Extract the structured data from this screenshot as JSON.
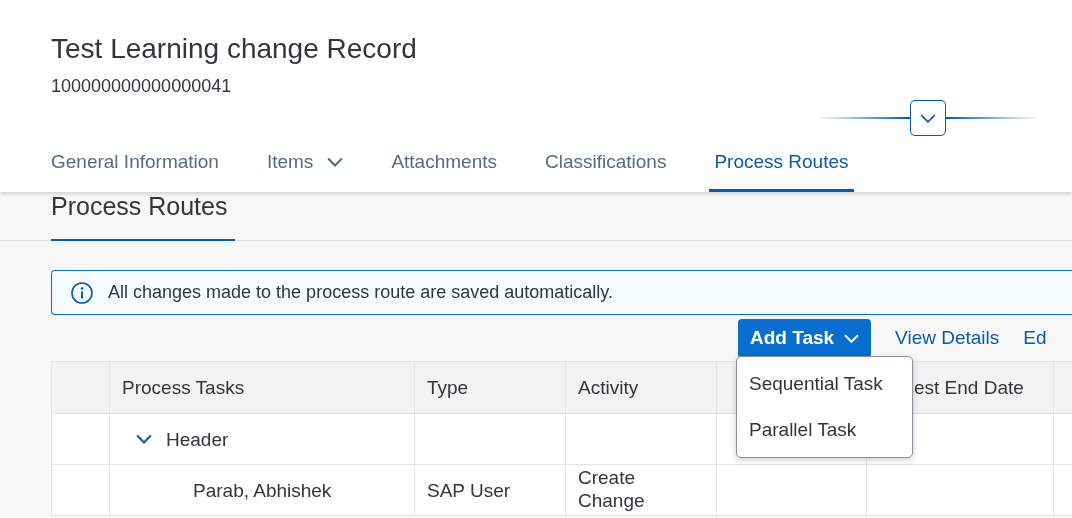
{
  "object_header": {
    "title": "Test Learning change Record",
    "number": "100000000000000041",
    "header_collapsed": false
  },
  "tabs": [
    {
      "label": "General Information",
      "selected": false,
      "has_menu": false
    },
    {
      "label": "Items",
      "selected": false,
      "has_menu": true
    },
    {
      "label": "Attachments",
      "selected": false,
      "has_menu": false
    },
    {
      "label": "Classifications",
      "selected": false,
      "has_menu": false
    },
    {
      "label": "Process Routes",
      "selected": true,
      "has_menu": false
    }
  ],
  "section": {
    "title": "Process Routes"
  },
  "info_strip": {
    "text": "All changes made to the process route are saved automatically."
  },
  "toolbar": {
    "add_button": "Add Task",
    "links": [
      "View Details",
      "Ed"
    ]
  },
  "add_menu": {
    "items": [
      "Sequential Task",
      "Parallel Task"
    ]
  },
  "table": {
    "columns": [
      {
        "label": "Process Tasks"
      },
      {
        "label": "Type"
      },
      {
        "label": "Activity"
      },
      {},
      {
        "label": "est End Date"
      },
      {}
    ],
    "rows": [
      {
        "cells": [
          {
            "text": "Header"
          },
          {},
          {},
          {},
          {},
          {}
        ],
        "expanded": true,
        "children": [
          {
            "cells": [
              {
                "text": "Parab, Abhishek"
              },
              {
                "text": "SAP User"
              },
              {
                "text": "Create Change"
              },
              {},
              {},
              {}
            ]
          }
        ]
      }
    ]
  }
}
